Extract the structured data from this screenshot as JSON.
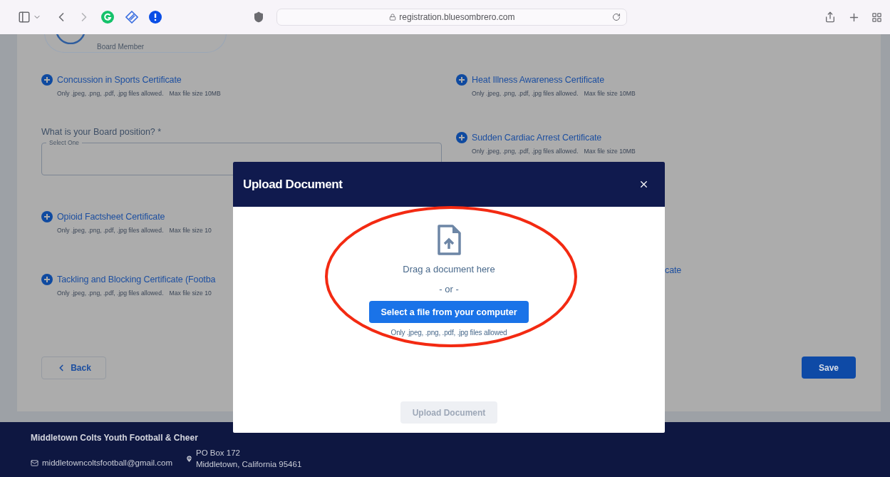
{
  "browser": {
    "url": "registration.bluesombrero.com"
  },
  "member_card": {
    "role": "Board Member"
  },
  "left_items": [
    {
      "kind": "certificate",
      "title": "Concussion in Sports Certificate",
      "hint_types": "Only .jpeg, .png, .pdf, .jpg files allowed.",
      "hint_size": "Max file size 10MB"
    },
    {
      "kind": "question",
      "label": "What is your Board position?",
      "required_mark": "*",
      "legend": "Select One"
    },
    {
      "kind": "certificate",
      "title": "Opioid Factsheet Certificate",
      "hint_types": "Only .jpeg, .png, .pdf, .jpg files allowed.",
      "hint_size": "Max file size 10"
    },
    {
      "kind": "certificate",
      "title": "Tackling and Blocking Certificate (Footba",
      "hint_types": "Only .jpeg, .png, .pdf, .jpg files allowed.",
      "hint_size": "Max file size 10"
    }
  ],
  "right_items": [
    {
      "kind": "certificate",
      "title": "Heat Illness Awareness Certificate",
      "hint_types": "Only .jpeg, .png, .pdf, .jpg files allowed.",
      "hint_size": "Max file size 10MB"
    },
    {
      "kind": "certificate",
      "title": "Sudden Cardiac Arrest Certificate",
      "hint_types": "Only .jpeg, .png, .pdf, .jpg files allowed.",
      "hint_size": "Max file size 10MB"
    },
    {
      "kind": "clipped",
      "title": "cate"
    }
  ],
  "actions": {
    "back": "Back",
    "save": "Save"
  },
  "footer": {
    "org": "Middletown Colts Youth Football & Cheer",
    "email": "middletowncoltsfootball@gmail.com",
    "address": [
      "PO Box 172",
      "Middletown, California 95461"
    ]
  },
  "modal": {
    "title": "Upload Document",
    "drop_text": "Drag a document here",
    "separator": "- or -",
    "select_button": "Select a file from your computer",
    "hint_lines": [
      "Only .jpeg, .png, .pdf, .jpg files allowed"
    ],
    "upload_button": {
      "label": "Upload Document",
      "disabled": true
    }
  },
  "annotation": {
    "kind": "ellipse"
  }
}
